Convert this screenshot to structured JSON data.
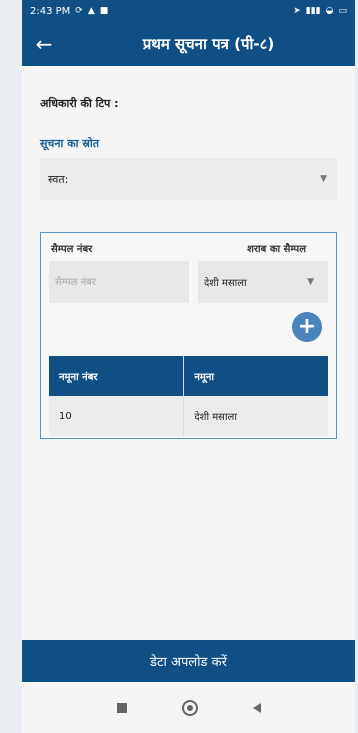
{
  "status_bar": {
    "time": "2:43 PM"
  },
  "header": {
    "title": "प्रथम सूचना पत्र (पी-८)",
    "back_icon": "←"
  },
  "form": {
    "officer_tip_label": "अधिकारी की टिप :",
    "source_label": "सूचना का स्रोत",
    "source_value": "स्वत:"
  },
  "sample": {
    "sample_number_label": "सैम्पल नंबर",
    "liquor_sample_label": "शराब का सैम्पल",
    "sample_number_placeholder": "सैम्पल नंबर",
    "liquor_selected": "देशी मसाला",
    "add_icon": "+",
    "table": {
      "headers": [
        "नमूना नंबर",
        "नमूना"
      ],
      "rows": [
        [
          "10",
          "देशी मसाला"
        ]
      ]
    }
  },
  "footer": {
    "upload_label": "डेटा अपलोड करें"
  }
}
